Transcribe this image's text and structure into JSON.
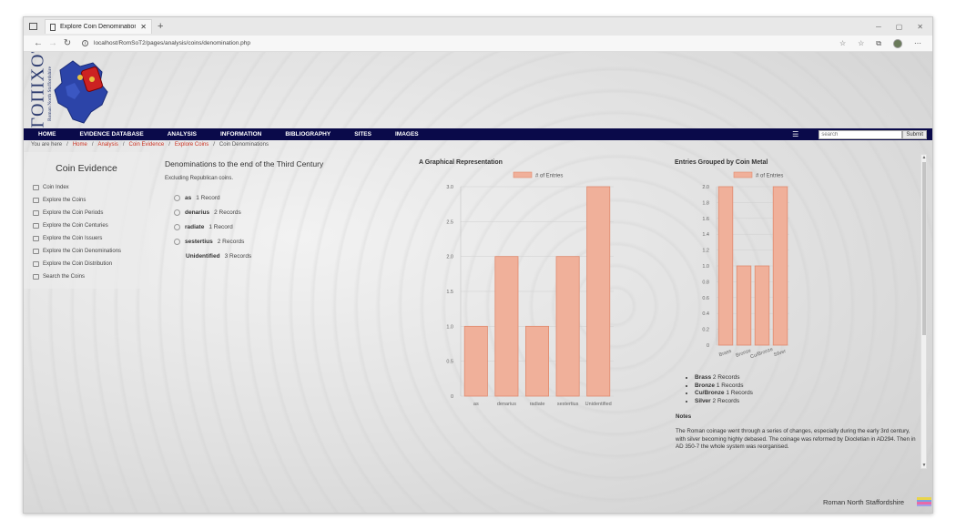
{
  "browser": {
    "tab_title": "Explore Coin Denominations",
    "url": "localhost/RomSoT2/pages/analysis/coins/denomination.php"
  },
  "logo": {
    "big": "ΓΟΠΙΧΟΤ",
    "small": "Roman North Staffordshire"
  },
  "menu": {
    "items": [
      "HOME",
      "EVIDENCE DATABASE",
      "ANALYSIS",
      "INFORMATION",
      "BIBLIOGRAPHY",
      "SITES",
      "IMAGES"
    ],
    "hamburger": "☰",
    "search_placeholder": "search",
    "submit_label": "Submit"
  },
  "breadcrumb": {
    "prefix": "You are here",
    "sep": "/",
    "links": [
      "Home",
      "Analysis",
      "Coin Evidence",
      "Explore Coins"
    ],
    "current": "Coin Denominations"
  },
  "sidebar": {
    "title": "Coin Evidence",
    "items": [
      "Coin Index",
      "Explore the Coins",
      "Explore the Coin Periods",
      "Explore the Coin Centuries",
      "Explore the Coin Issuers",
      "Explore the Coin Denominations",
      "Explore the Coin Distribution",
      "Search the Coins"
    ]
  },
  "denominations": {
    "title": "Denominations to the end of the Third Century",
    "subtitle": "Excluding Republican coins.",
    "rows": [
      {
        "name": "as",
        "count": "1 Record"
      },
      {
        "name": "denarius",
        "count": "2 Records"
      },
      {
        "name": "radiate",
        "count": "1 Record"
      },
      {
        "name": "sestertius",
        "count": "2 Records"
      },
      {
        "name": "Unidentified",
        "count": "3 Records"
      }
    ]
  },
  "colors": {
    "bar_fill": "#f0b09a",
    "bar_stroke": "#e08a6e",
    "menu_bg": "#0a0a4a",
    "link": "#cc3322"
  },
  "chart_data": [
    {
      "type": "bar",
      "title": "A Graphical Representation",
      "categories": [
        "as",
        "denarius",
        "radiate",
        "sestertius",
        "Unidentified"
      ],
      "series": [
        {
          "name": "# of Entries",
          "values": [
            1,
            2,
            1,
            2,
            3
          ]
        }
      ],
      "ylim": [
        0,
        3
      ],
      "yticks": [
        "0",
        "0.5",
        "1.0",
        "1.5",
        "2.0",
        "2.5",
        "3.0"
      ],
      "legend": "top",
      "grid": true
    },
    {
      "type": "bar",
      "title": "Entries Grouped by Coin Metal",
      "categories": [
        "Brass",
        "Bronze",
        "Cu/Bronze",
        "Silver"
      ],
      "series": [
        {
          "name": "# of Entries",
          "values": [
            2,
            1,
            1,
            2
          ]
        }
      ],
      "ylim": [
        0,
        2
      ],
      "yticks": [
        "0",
        "0.2",
        "0.4",
        "0.6",
        "0.8",
        "1.0",
        "1.2",
        "1.4",
        "1.6",
        "1.8",
        "2.0"
      ],
      "legend": "top",
      "grid": true
    }
  ],
  "metals": [
    {
      "name": "Brass",
      "count": "2 Records"
    },
    {
      "name": "Bronze",
      "count": "1 Records"
    },
    {
      "name": "Cu/Bronze",
      "count": "1 Records"
    },
    {
      "name": "Silver",
      "count": "2 Records"
    }
  ],
  "notes": {
    "title": "Notes",
    "text": "The Roman coinage went through a series of changes, especially during the early 3rd century, with silver becoming highly debased. The coinage was reformed by Diocletian in AD294. Then in AD 350-7 the whole system was reorganised."
  },
  "footer": {
    "brand": "Roman North Staffordshire"
  }
}
